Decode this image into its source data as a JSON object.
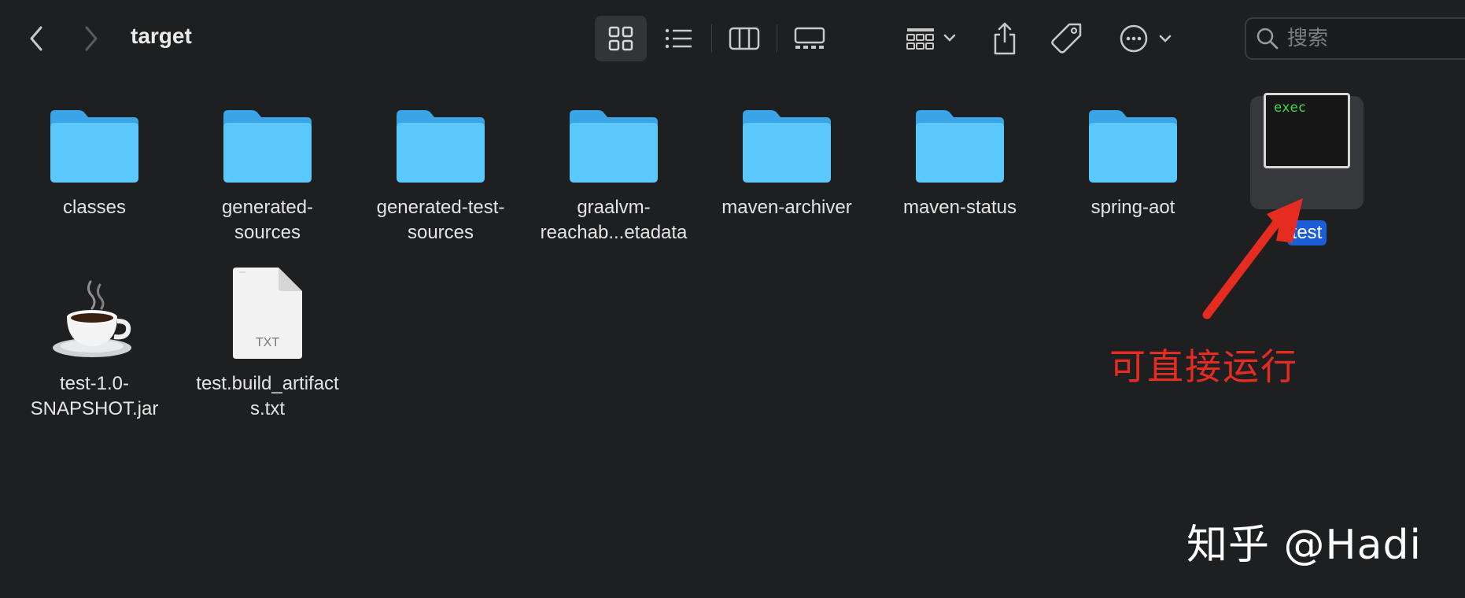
{
  "window": {
    "title": "target"
  },
  "toolbar": {
    "back_icon": "chevron-left-icon",
    "forward_icon": "chevron-right-icon",
    "views": [
      "icon-view-icon",
      "list-view-icon",
      "column-view-icon",
      "gallery-view-icon"
    ],
    "active_view": "icon-view-icon",
    "group_icon": "group-icon",
    "share_icon": "share-icon",
    "tag_icon": "tag-icon",
    "more_icon": "more-icon",
    "search": {
      "placeholder": "搜索"
    }
  },
  "items": [
    {
      "name": "classes",
      "kind": "folder"
    },
    {
      "name": "generated-\nsources",
      "kind": "folder"
    },
    {
      "name": "generated-test-\nsources",
      "kind": "folder"
    },
    {
      "name": "graalvm-\nreachab...etadata",
      "kind": "folder"
    },
    {
      "name": "maven-archiver",
      "kind": "folder"
    },
    {
      "name": "maven-status",
      "kind": "folder"
    },
    {
      "name": "spring-aot",
      "kind": "folder"
    },
    {
      "name": "test",
      "kind": "exec",
      "selected": true,
      "icon_text": "exec"
    },
    {
      "name": "test-1.0-\nSNAPSHOT.jar",
      "kind": "jar"
    },
    {
      "name": "test.build_artifact\ns.txt",
      "kind": "txt",
      "icon_text": "TXT"
    }
  ],
  "annotation": {
    "text": "可直接运行",
    "color": "#e62c21"
  },
  "watermark": "知乎 @Hadi",
  "colors": {
    "folder": "#5ac8fa",
    "selection": "#1b5ed6"
  }
}
